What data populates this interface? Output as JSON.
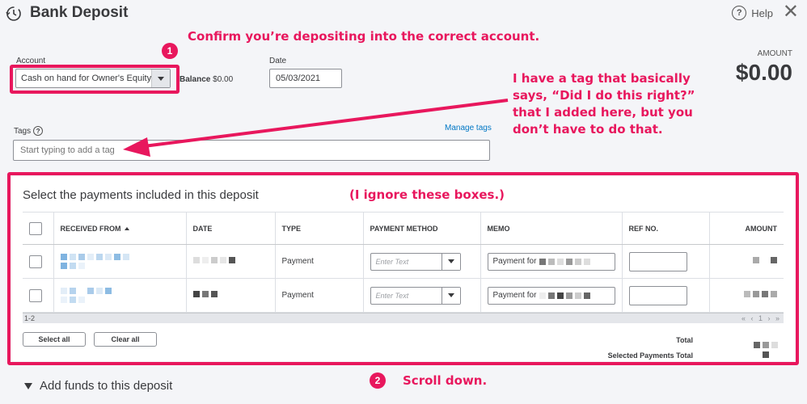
{
  "header": {
    "title": "Bank Deposit",
    "help_label": "Help",
    "close_glyph": "✕"
  },
  "annotations": {
    "confirm_account": "Confirm you’re depositing into the correct account.",
    "tag_note": "I have a tag that basically says, “Did I do this right?” that I added here, but you don’t have to do that.",
    "ignore_boxes": "(I ignore these boxes.)",
    "scroll_down": "Scroll down.",
    "badge_1": "1",
    "badge_2": "2"
  },
  "form": {
    "account_label": "Account",
    "account_value": "Cash on hand for Owner's Equity",
    "balance_label": "Balance",
    "balance_value": "$0.00",
    "date_label": "Date",
    "date_value": "05/03/2021",
    "amount_label": "AMOUNT",
    "amount_value": "$0.00",
    "tags_label": "Tags",
    "manage_tags": "Manage tags",
    "tags_placeholder": "Start typing to add a tag"
  },
  "payments": {
    "title": "Select the payments included in this deposit",
    "columns": [
      "RECEIVED FROM",
      "DATE",
      "TYPE",
      "PAYMENT METHOD",
      "MEMO",
      "REF NO.",
      "AMOUNT"
    ],
    "rows": [
      {
        "type": "Payment",
        "payment_method_placeholder": "Enter Text",
        "memo_prefix": "Payment for"
      },
      {
        "type": "Payment",
        "payment_method_placeholder": "Enter Text",
        "memo_prefix": "Payment for"
      }
    ],
    "count_label": "1-2",
    "pager": "« ‹ 1 › »",
    "select_all": "Select all",
    "clear_all": "Clear all",
    "total_label": "Total",
    "selected_total_label": "Selected Payments Total"
  },
  "section": {
    "add_funds": "Add funds to this deposit"
  },
  "colors": {
    "annotation": "#e8175d",
    "link": "#0077c5",
    "background": "#f4f5f8"
  }
}
